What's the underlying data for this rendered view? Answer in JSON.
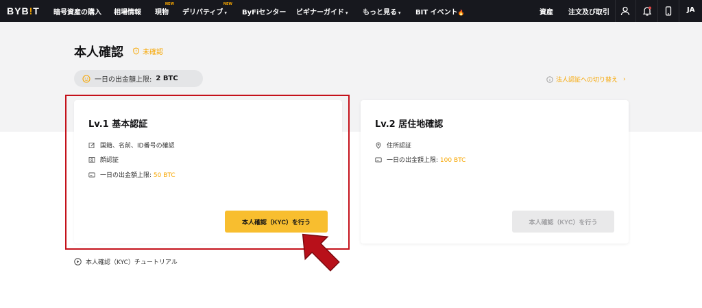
{
  "nav": {
    "logo_main": "BYB",
    "logo_accent": "!",
    "logo_end": "T",
    "items": [
      {
        "label": "暗号資産の購入"
      },
      {
        "label": "相場情報"
      },
      {
        "label": "現物",
        "badge": "NEW"
      },
      {
        "label": "デリバティブ",
        "badge": "NEW",
        "caret": "▾"
      },
      {
        "label": "ByFiセンター"
      },
      {
        "label": "ビギナーガイド",
        "caret": "▾"
      },
      {
        "label": "もっと見る",
        "caret": "▾"
      },
      {
        "label": "BIT イベント",
        "flame": "🔥"
      }
    ],
    "assets": "資産",
    "orders": "注文及び取引",
    "lang": "JA"
  },
  "page": {
    "title": "本人確認",
    "status": "未確認",
    "limit_label": "一日の出金額上限:",
    "limit_value": "2 BTC",
    "corp_link": "法人認証への切り替え",
    "corp_chevron": "›"
  },
  "cards": [
    {
      "title": "Lv.1 基本認証",
      "features": [
        {
          "text": "国籍、名前、ID番号の確認"
        },
        {
          "text": "顔認証"
        },
        {
          "text": "一日の出金額上限: ",
          "highlight": "50 BTC"
        }
      ],
      "button": "本人確認（KYC）を行う"
    },
    {
      "title": "Lv.2 居住地確認",
      "features": [
        {
          "text": "住所認証"
        },
        {
          "text": "一日の出金額上限: ",
          "highlight": "100 BTC"
        }
      ],
      "button": "本人確認（KYC）を行う"
    }
  ],
  "tutorial": "本人確認（KYC）チュートリアル",
  "colors": {
    "accent": "#f7a600",
    "button": "#f8be2f",
    "nav_bg": "#17181e",
    "highlight_red": "#c4111a"
  },
  "icons": [
    "user-icon",
    "bell-icon",
    "phone-icon",
    "shield-icon",
    "info-icon",
    "edit-icon",
    "face-id-icon",
    "card-icon",
    "location-icon",
    "play-icon",
    "arrow-pointer-icon"
  ]
}
